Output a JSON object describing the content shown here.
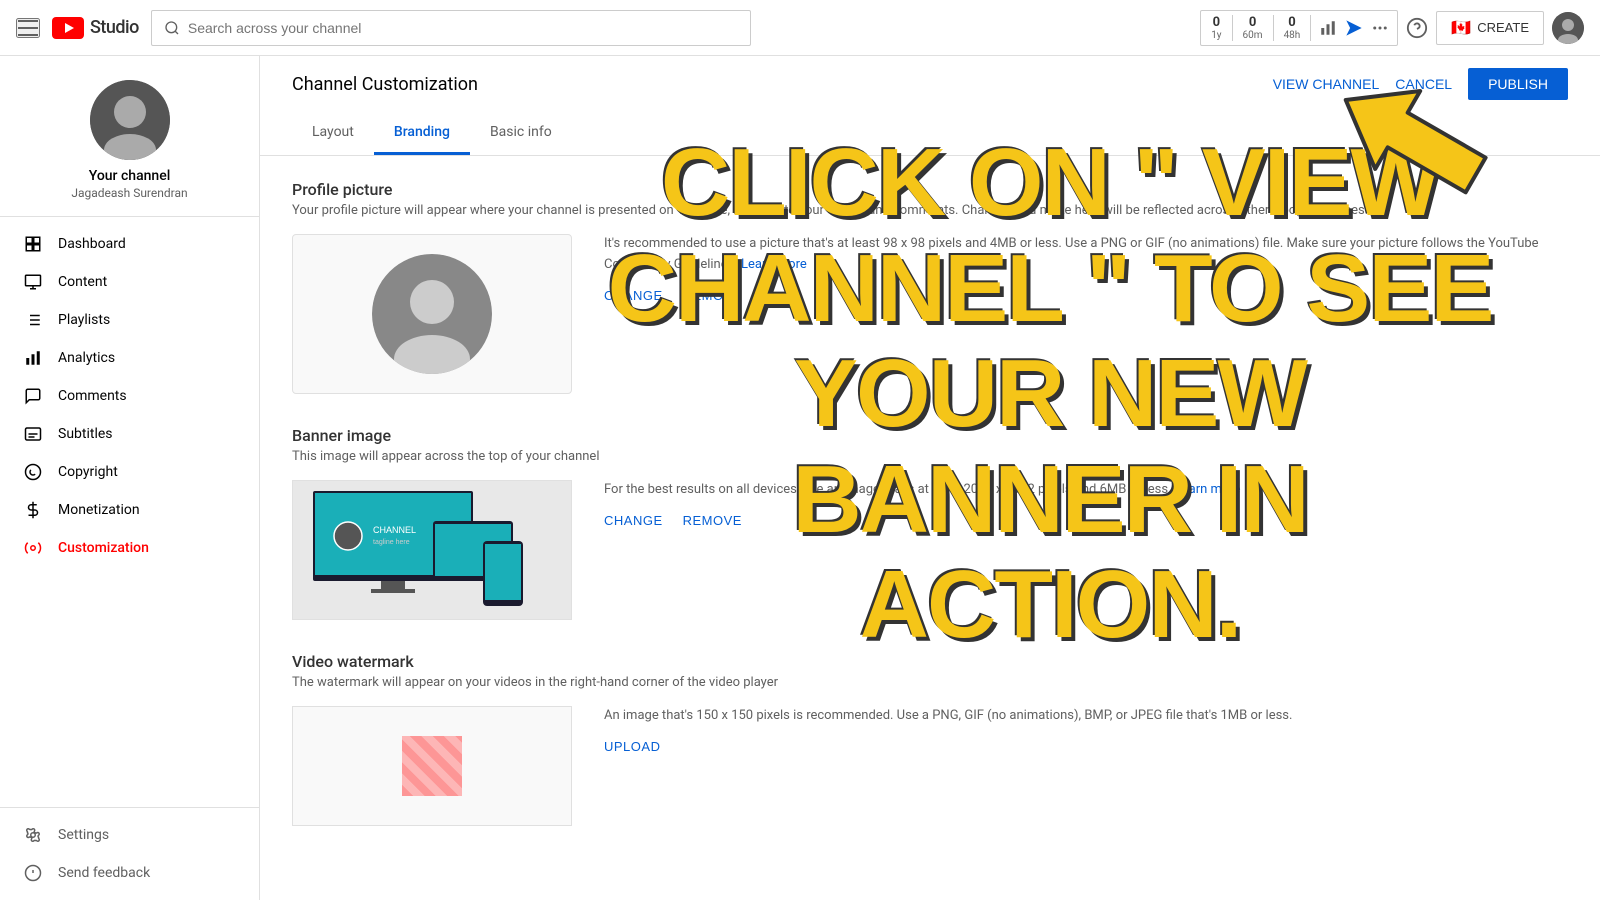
{
  "topNav": {
    "searchPlaceholder": "Search across your channel",
    "stats": [
      {
        "value": "0",
        "label": "1y"
      },
      {
        "value": "0",
        "label": "60m"
      },
      {
        "value": "0",
        "label": "48h"
      }
    ],
    "createLabel": "CREATE",
    "helpIcon": "question-circle",
    "flagEmoji": "🇨🇦"
  },
  "sidebar": {
    "channelName": "Your channel",
    "channelHandle": "Jagadeash Surendran",
    "navItems": [
      {
        "id": "dashboard",
        "label": "Dashboard",
        "icon": "dashboard"
      },
      {
        "id": "content",
        "label": "Content",
        "icon": "video"
      },
      {
        "id": "playlists",
        "label": "Playlists",
        "icon": "playlists"
      },
      {
        "id": "analytics",
        "label": "Analytics",
        "icon": "analytics"
      },
      {
        "id": "comments",
        "label": "Comments",
        "icon": "comments"
      },
      {
        "id": "subtitles",
        "label": "Subtitles",
        "icon": "subtitles"
      },
      {
        "id": "copyright",
        "label": "Copyright",
        "icon": "copyright"
      },
      {
        "id": "monetization",
        "label": "Monetization",
        "icon": "monetization"
      },
      {
        "id": "customization",
        "label": "Customization",
        "icon": "customization",
        "active": true
      }
    ],
    "bottomItems": [
      {
        "id": "settings",
        "label": "Settings",
        "icon": "settings"
      },
      {
        "id": "feedback",
        "label": "Send feedback",
        "icon": "feedback"
      }
    ]
  },
  "page": {
    "title": "Channel Customization",
    "tabs": [
      {
        "id": "layout",
        "label": "Layout"
      },
      {
        "id": "branding",
        "label": "Branding",
        "active": true
      },
      {
        "id": "basicinfo",
        "label": "Basic info"
      }
    ],
    "actions": {
      "viewChannel": "VIEW CHANNEL",
      "cancel": "CANCEL",
      "publish": "PUBLISH"
    }
  },
  "sections": {
    "profilePicture": {
      "title": "Profile picture",
      "desc": "Your profile picture will appear where your channel is presented on YouTube, like next to your videos and comments. Changes you make here will be reflected across other Google services.",
      "infoText": "It's recommended to use a picture that's at least 98 x 98 pixels and 4MB or less. Use a PNG or GIF (no animations) file. Make sure your picture follows the YouTube Community Guidelines.",
      "learnMoreLabel": "Learn more",
      "changeLabel": "CHANGE",
      "removeLabel": "REMOVE"
    },
    "bannerImage": {
      "title": "Banner image",
      "desc": "This image will appear across the top of your channel",
      "infoText": "For the best results on all devices, use an image that's at least 2048 x 1152 pixels and 6MB or less.",
      "learnMoreLabel": "Learn more",
      "changeLabel": "CHANGE",
      "removeLabel": "REMOVE"
    },
    "videoWatermark": {
      "title": "Video watermark",
      "desc": "The watermark will appear on your videos in the right-hand corner of the video player",
      "infoText": "An image that's 150 x 150 pixels is recommended. Use a PNG, GIF (no animations), BMP, or JPEG file that's 1MB or less.",
      "uploadLabel": "UPLOAD"
    }
  },
  "overlay": {
    "text": "CLICK ON \" VIEW CHANNEL \" TO SEE YOUR NEW BANNER IN ACTION."
  }
}
